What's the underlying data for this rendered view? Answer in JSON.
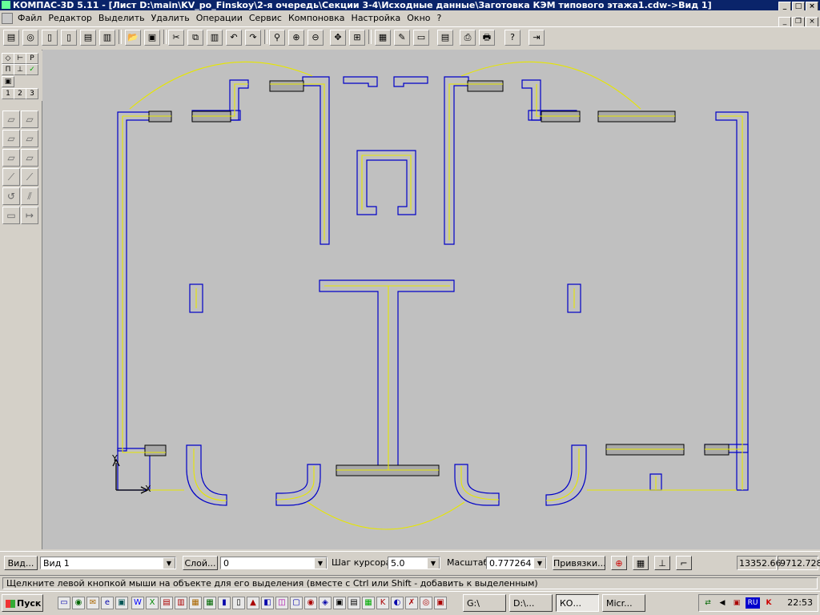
{
  "window": {
    "title": "КОМПАС-3D 5.11 - [Лист D:\\main\\KV_po_Finskoy\\2-я очередь\\Секции 3-4\\Исходные данные\\Заготовка КЭМ типового этажа1.cdw->Вид 1]",
    "controls": {
      "minimize": "_",
      "maximize": "□",
      "close": "×"
    }
  },
  "menu": {
    "items": [
      "Файл",
      "Редактор",
      "Выделить",
      "Удалить",
      "Операции",
      "Сервис",
      "Компоновка",
      "Настройка",
      "Окно",
      "?"
    ],
    "mdi_controls": {
      "minimize": "_",
      "restore": "❐",
      "close": "×"
    }
  },
  "left_panel": {
    "top_buttons": [
      "◇",
      "⊢",
      "Р",
      "П",
      "⊥",
      "✓",
      "▣",
      "1",
      "2",
      "3"
    ],
    "tool_buttons": [
      "▱",
      "▱",
      "▱",
      "▱",
      "▱",
      "▱",
      "⟋",
      "⟋",
      "↺",
      "⫽",
      "▭",
      "↦"
    ]
  },
  "drawing": {
    "axis_x": "X",
    "axis_y": "Y",
    "colors": {
      "wall": "#0000c8",
      "axis": "#e6e600",
      "background": "#c0c0c0",
      "dark": "#000000"
    }
  },
  "status": {
    "view_button": "Вид...",
    "view_value": "Вид 1",
    "layer_button": "Слой...",
    "layer_value": "0",
    "step_label": "Шаг курсора",
    "step_value": "5.0",
    "scale_label": "Масштаб",
    "scale_value": "0.777264",
    "snap_button": "Привязки...",
    "coord_x": "13352.66",
    "coord_y": "9712.728"
  },
  "hint": "Щелкните левой кнопкой мыши на объекте для его выделения (вместе с Ctrl или Shift - добавить к выделенным)",
  "taskbar": {
    "start": "Пуск",
    "tasks": [
      {
        "label": "G:\\",
        "active": false
      },
      {
        "label": "D:\\...",
        "active": false
      },
      {
        "label": "КО...",
        "active": true
      },
      {
        "label": "Micr...",
        "active": false
      }
    ],
    "lang": "RU",
    "clock": "22:53"
  }
}
